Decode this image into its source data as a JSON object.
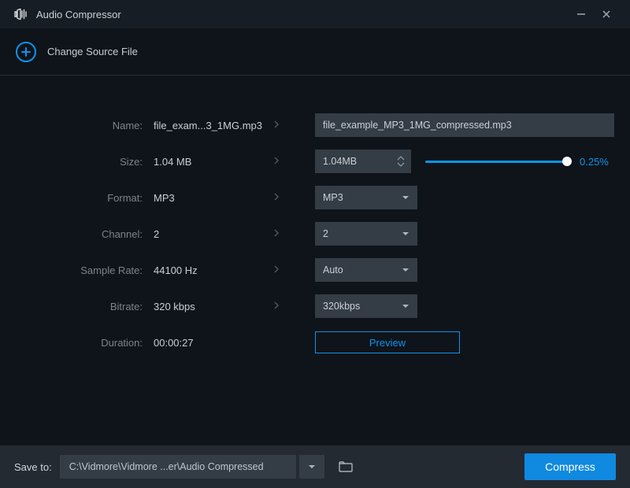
{
  "titlebar": {
    "title": "Audio Compressor"
  },
  "change_source": {
    "label": "Change Source File"
  },
  "rows": {
    "name": {
      "label": "Name:",
      "source": "file_exam...3_1MG.mp3",
      "target": "file_example_MP3_1MG_compressed.mp3"
    },
    "size": {
      "label": "Size:",
      "source": "1.04 MB",
      "target": "1.04MB",
      "percent": "0.25%"
    },
    "format": {
      "label": "Format:",
      "source": "MP3",
      "target": "MP3"
    },
    "channel": {
      "label": "Channel:",
      "source": "2",
      "target": "2"
    },
    "sample_rate": {
      "label": "Sample Rate:",
      "source": "44100 Hz",
      "target": "Auto"
    },
    "bitrate": {
      "label": "Bitrate:",
      "source": "320 kbps",
      "target": "320kbps"
    },
    "duration": {
      "label": "Duration:",
      "source": "00:00:27"
    }
  },
  "preview": {
    "label": "Preview"
  },
  "bottom": {
    "save_label": "Save to:",
    "path": "C:\\Vidmore\\Vidmore ...er\\Audio Compressed",
    "compress_label": "Compress"
  }
}
